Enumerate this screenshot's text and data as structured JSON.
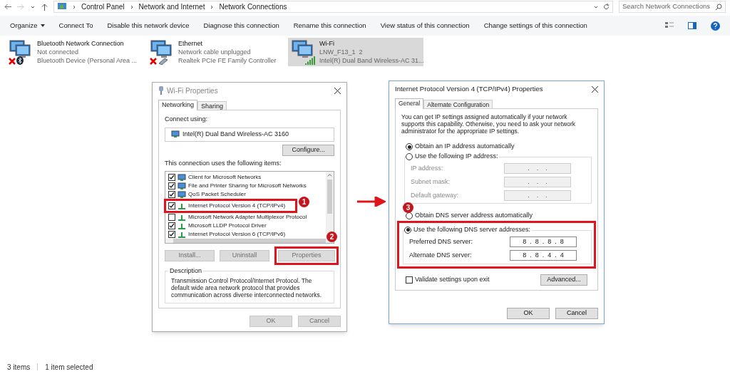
{
  "address_bar": {
    "breadcrumbs": [
      "Control Panel",
      "Network and Internet",
      "Network Connections"
    ],
    "search": {
      "placeholder": "Search Network Connections"
    }
  },
  "toolbar": {
    "items": [
      {
        "label": "Organize",
        "kind": "menu"
      },
      {
        "label": "Connect To",
        "kind": "command"
      },
      {
        "label": "Disable this network device",
        "kind": "command"
      },
      {
        "label": "Diagnose this connection",
        "kind": "command"
      },
      {
        "label": "Rename this connection",
        "kind": "command"
      },
      {
        "label": "View status of this connection",
        "kind": "command"
      },
      {
        "label": "Change settings of this connection",
        "kind": "command"
      }
    ]
  },
  "adapters": [
    {
      "name": "Bluetooth Network Connection",
      "status": "Not connected",
      "device": "Bluetooth Device (Personal Area ...",
      "kind": "bluetooth",
      "connected": false,
      "selected": false
    },
    {
      "name": "Ethernet",
      "status": "Network cable unplugged",
      "device": "Realtek PCIe FE Family Controller",
      "kind": "ethernet",
      "connected": false,
      "selected": false
    },
    {
      "name": "Wi-Fi",
      "status": "LNW_F13_1  2",
      "device": "Intel(R) Dual Band Wireless-AC 31...",
      "kind": "wifi",
      "connected": true,
      "selected": true
    }
  ],
  "wifi_properties": {
    "title": "Wi-Fi Properties",
    "tabs": [
      {
        "label": "Networking",
        "selected": true
      },
      {
        "label": "Sharing",
        "selected": false
      }
    ],
    "connect_using_label": "Connect using:",
    "adapter": "Intel(R) Dual Band Wireless-AC 3160",
    "configure_button": "Configure...",
    "items_label": "This connection uses the following items:",
    "items": [
      {
        "label": "Client for Microsoft Networks",
        "checked": true,
        "kind": "client",
        "highlighted": false
      },
      {
        "label": "File and Printer Sharing for Microsoft Networks",
        "checked": true,
        "kind": "client",
        "highlighted": false
      },
      {
        "label": "QoS Packet Scheduler",
        "checked": true,
        "kind": "client",
        "highlighted": false
      },
      {
        "label": "Internet Protocol Version 4 (TCP/IPv4)",
        "checked": true,
        "kind": "protocol",
        "highlighted": true
      },
      {
        "label": "Microsoft Network Adapter Multiplexor Protocol",
        "checked": false,
        "kind": "protocol",
        "highlighted": false
      },
      {
        "label": "Microsoft LLDP Protocol Driver",
        "checked": true,
        "kind": "protocol",
        "highlighted": false
      },
      {
        "label": "Internet Protocol Version 6 (TCP/IPv6)",
        "checked": true,
        "kind": "protocol",
        "highlighted": false
      }
    ],
    "buttons": [
      {
        "label": "Install...",
        "disabled": true,
        "highlighted": false
      },
      {
        "label": "Uninstall",
        "disabled": true,
        "highlighted": false
      },
      {
        "label": "Properties",
        "disabled": true,
        "highlighted": true
      }
    ],
    "description_label": "Description",
    "description": "Transmission Control Protocol/Internet Protocol. The default wide area network protocol that provides communication across diverse interconnected networks.",
    "footer_buttons": [
      {
        "label": "OK",
        "disabled": true
      },
      {
        "label": "Cancel",
        "disabled": true
      }
    ]
  },
  "ipv4_properties": {
    "title": "Internet Protocol Version 4 (TCP/IPv4) Properties",
    "tabs": [
      {
        "label": "General",
        "selected": true
      },
      {
        "label": "Alternate Configuration",
        "selected": false
      }
    ],
    "intro": "You can get IP settings assigned automatically if your network supports this capability. Otherwise, you need to ask your network administrator for the appropriate IP settings.",
    "ip_options": [
      {
        "label": "Obtain an IP address automatically",
        "selected": true
      },
      {
        "label": "Use the following IP address:",
        "selected": false
      }
    ],
    "ip_fields": [
      {
        "label": "IP address:",
        "value": ".    .    .",
        "disabled": true
      },
      {
        "label": "Subnet mask:",
        "value": ".    .    .",
        "disabled": true
      },
      {
        "label": "Default gateway:",
        "value": ".    .    .",
        "disabled": true
      }
    ],
    "dns_options": [
      {
        "label": "Obtain DNS server address automatically",
        "selected": false
      },
      {
        "label": "Use the following DNS server addresses:",
        "selected": true
      }
    ],
    "dns_fields": [
      {
        "label": "Preferred DNS server:",
        "value": "8  .  8  .  8  .  8",
        "disabled": false
      },
      {
        "label": "Alternate DNS server:",
        "value": "8  .  8  .  4  .  4",
        "disabled": false
      }
    ],
    "validate": {
      "label": "Validate settings upon exit",
      "checked": false
    },
    "advanced_button": "Advanced...",
    "footer_buttons": [
      {
        "label": "OK",
        "disabled": false
      },
      {
        "label": "Cancel",
        "disabled": false
      }
    ]
  },
  "annotations": [
    "1",
    "2",
    "3"
  ],
  "status_bar": {
    "count": "3 items",
    "selection": "1 item selected"
  }
}
